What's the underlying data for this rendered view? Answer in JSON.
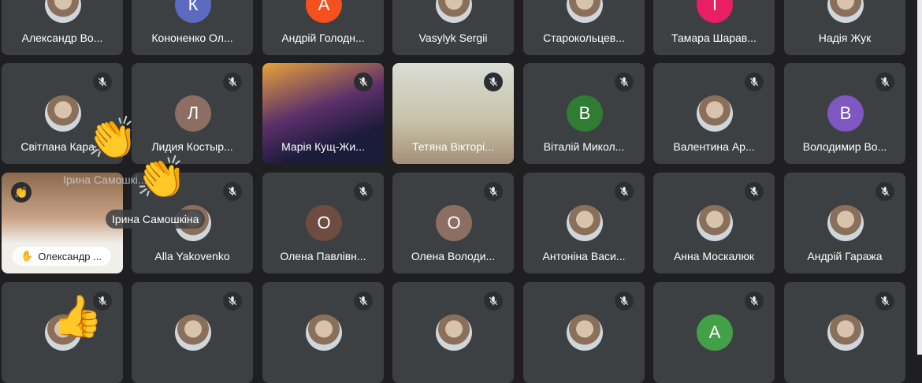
{
  "participants": [
    {
      "name": "Александр Во...",
      "avatar": "photo"
    },
    {
      "name": "Кононенко Ол...",
      "avatar": "К",
      "color": "#5c6bc0"
    },
    {
      "name": "Андрій Голодн...",
      "avatar": "А",
      "color": "#f4511e"
    },
    {
      "name": "Vasylyk Sergii",
      "avatar": "photo"
    },
    {
      "name": "Старокольцев...",
      "avatar": "photo"
    },
    {
      "name": "Тамара Шарав...",
      "avatar": "Т",
      "color": "#e91e63"
    },
    {
      "name": "Надія Жук",
      "avatar": "photo"
    },
    {
      "name": "Світлана Кара...",
      "avatar": "photo"
    },
    {
      "name": "Лидия Костыр...",
      "avatar": "Л",
      "color": "#8d6e63"
    },
    {
      "name": "Марія Кущ-Жи...",
      "avatar": "video"
    },
    {
      "name": "Тетяна Вікторі...",
      "avatar": "video2"
    },
    {
      "name": "Віталій Микол...",
      "avatar": "В",
      "color": "#2e7d32"
    },
    {
      "name": "Валентина Ар...",
      "avatar": "photo"
    },
    {
      "name": "Володимир Во...",
      "avatar": "В",
      "color": "#7e57c2"
    },
    {
      "name": "Олександр ...",
      "avatar": "video3"
    },
    {
      "name": "Alla Yakovenko",
      "avatar": "photo"
    },
    {
      "name": "Олена Павлівн...",
      "avatar": "О",
      "color": "#6d4c41"
    },
    {
      "name": "Олена Володи...",
      "avatar": "О",
      "color": "#8d6e63"
    },
    {
      "name": "Антоніна Васи...",
      "avatar": "photo"
    },
    {
      "name": "Анна Москалюк",
      "avatar": "photo"
    },
    {
      "name": "Андрій Гаража",
      "avatar": "photo"
    },
    {
      "name": "",
      "avatar": "photo"
    },
    {
      "name": "",
      "avatar": "photo"
    },
    {
      "name": "",
      "avatar": "photo"
    },
    {
      "name": "",
      "avatar": "photo"
    },
    {
      "name": "",
      "avatar": "photo"
    },
    {
      "name": "",
      "avatar": "А",
      "color": "#43a047"
    },
    {
      "name": "",
      "avatar": "photo"
    }
  ],
  "reactions": {
    "clap_label_top": "Ірина Самошкі...",
    "clap_label_main": "Ірина Самошкіна",
    "clap_emoji": "👏",
    "thumb_emoji": "👍",
    "hand_emoji": "✋"
  },
  "icons": {
    "mic_off": "mic-off-icon",
    "hand": "hand-icon"
  }
}
